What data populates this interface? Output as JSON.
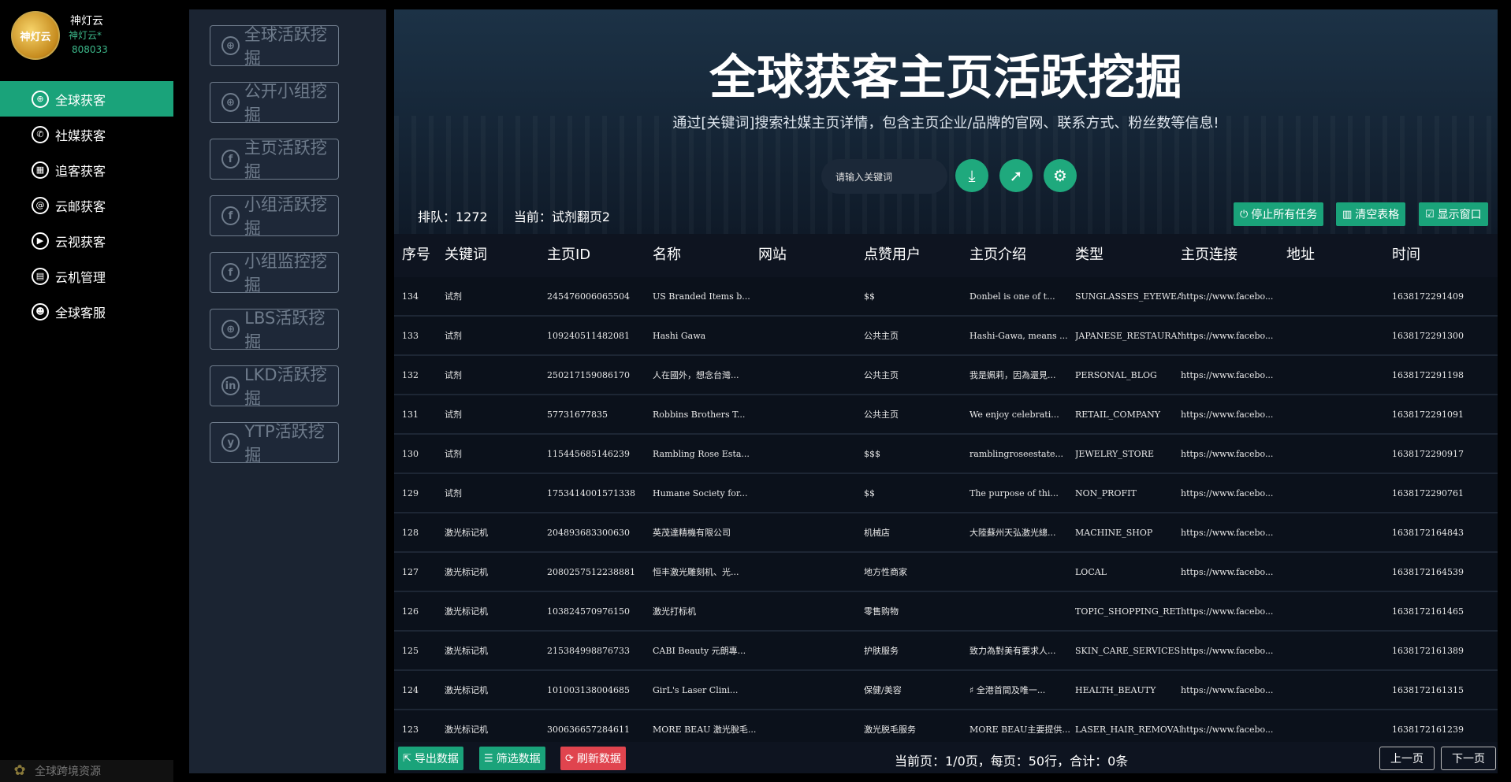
{
  "brand": {
    "name": "神灯云",
    "sub": "神灯云*",
    "id": "808033",
    "logo_text": "神灯云"
  },
  "nav": [
    {
      "label": "全球获客",
      "icon": "globe-icon",
      "glyph": "⊕",
      "active": true
    },
    {
      "label": "社媒获客",
      "icon": "whatsapp-icon",
      "glyph": "✆",
      "active": false
    },
    {
      "label": "追客获客",
      "icon": "grid-icon",
      "glyph": "▦",
      "active": false
    },
    {
      "label": "云邮获客",
      "icon": "mail-icon",
      "glyph": "@",
      "active": false
    },
    {
      "label": "云视获客",
      "icon": "play-icon",
      "glyph": "▶",
      "active": false
    },
    {
      "label": "云机管理",
      "icon": "server-icon",
      "glyph": "▤",
      "active": false
    },
    {
      "label": "全球客服",
      "icon": "support-icon",
      "glyph": "☻",
      "active": false
    }
  ],
  "sidebar_footer": "全球跨境资源",
  "mining_buttons": [
    {
      "label": "全球活跃挖掘",
      "icon": "globe-icon",
      "glyph": "⊕"
    },
    {
      "label": "公开小组挖掘",
      "icon": "globe-icon",
      "glyph": "⊕"
    },
    {
      "label": "主页活跃挖掘",
      "icon": "facebook-icon",
      "glyph": "f"
    },
    {
      "label": "小组活跃挖掘",
      "icon": "facebook-icon",
      "glyph": "f"
    },
    {
      "label": "小组监控挖掘",
      "icon": "facebook-icon",
      "glyph": "f"
    },
    {
      "label": "LBS活跃挖掘",
      "icon": "globe-icon",
      "glyph": "⊕"
    },
    {
      "label": "LKD活跃挖掘",
      "icon": "linkedin-icon",
      "glyph": "in"
    },
    {
      "label": "YTP活跃挖掘",
      "icon": "yelp-icon",
      "glyph": "y"
    }
  ],
  "hero": {
    "title": "全球获客主页活跃挖掘",
    "subtitle": "通过[关键词]搜索社媒主页详情，包含主页企业/品牌的官网、联系方式、粉丝数等信息!",
    "search_placeholder": "请输入关键词"
  },
  "status": {
    "queue": "排队：1272",
    "current": "当前：试剂翻页2"
  },
  "actions": {
    "stop": "停止所有任务",
    "clear": "清空表格",
    "show": "显示窗口"
  },
  "table": {
    "headers": [
      "序号",
      "关键词",
      "主页ID",
      "名称",
      "网站",
      "点赞用户",
      "主页介绍",
      "类型",
      "主页连接",
      "地址",
      "时间"
    ],
    "rows": [
      [
        "134",
        "试剂",
        "245476006065504",
        "US Branded Items b...",
        "",
        "$$",
        "Donbel is one of t...",
        "SUNGLASSES_EYEWEAR...",
        "https://www.facebo...",
        "",
        "1638172291409"
      ],
      [
        "133",
        "试剂",
        "109240511482081",
        "Hashi Gawa",
        "",
        "公共主页",
        "Hashi-Gawa, means ...",
        "JAPANESE_RESTAURANT",
        "https://www.facebo...",
        "",
        "1638172291300"
      ],
      [
        "132",
        "试剂",
        "250217159086170",
        "人在國外，想念台灣...",
        "",
        "公共主页",
        "我是姵莉，因為還見...",
        "PERSONAL_BLOG",
        "https://www.facebo...",
        "",
        "1638172291198"
      ],
      [
        "131",
        "试剂",
        "57731677835",
        "Robbins Brothers T...",
        "",
        "公共主页",
        "We enjoy celebrati...",
        "RETAIL_COMPANY",
        "https://www.facebo...",
        "",
        "1638172291091"
      ],
      [
        "130",
        "试剂",
        "115445685146239",
        "Rambling Rose Esta...",
        "",
        "$$$",
        "ramblingroseestate...",
        "JEWELRY_STORE",
        "https://www.facebo...",
        "",
        "1638172290917"
      ],
      [
        "129",
        "试剂",
        "1753414001571338",
        "Humane Society for...",
        "",
        "$$",
        "The purpose of thi...",
        "NON_PROFIT",
        "https://www.facebo...",
        "",
        "1638172290761"
      ],
      [
        "128",
        "激光标记机",
        "204893683300630",
        "英茂達精機有限公司",
        "",
        "机械店",
        "大陸蘇州天弘激光總...",
        "MACHINE_SHOP",
        "https://www.facebo...",
        "",
        "1638172164843"
      ],
      [
        "127",
        "激光标记机",
        "2080257512238881",
        "恒丰激光雕刻机、光...",
        "",
        "地方性商家",
        "",
        "LOCAL",
        "https://www.facebo...",
        "",
        "1638172164539"
      ],
      [
        "126",
        "激光标记机",
        "103824570976150",
        "激光打标机",
        "",
        "零售购物",
        "",
        "TOPIC_SHOPPING_RETAIL",
        "https://www.facebo...",
        "",
        "1638172161465"
      ],
      [
        "125",
        "激光标记机",
        "215384998876733",
        "CABI Beauty 元朗專...",
        "",
        "护肤服务",
        "致力為對美有要求人...",
        "SKIN_CARE_SERVICES",
        "https://www.facebo...",
        "",
        "1638172161389"
      ],
      [
        "124",
        "激光标记机",
        "101003138004685",
        "GirL's Laser Clini...",
        "",
        "保健/美容",
        "    ♯  全港首間及唯一...",
        "HEALTH_BEAUTY",
        "https://www.facebo...",
        "",
        "1638172161315"
      ],
      [
        "123",
        "激光标记机",
        "300636657284611",
        "MORE BEAU 激光脫毛...",
        "",
        "激光脱毛服务",
        "MORE BEAU主要提供...",
        "LASER_HAIR_REMOVAL",
        "https://www.facebo...",
        "",
        "1638172161239"
      ]
    ]
  },
  "footer": {
    "export": "导出数据",
    "filter": "筛选数据",
    "refresh": "刷新数据",
    "pager": "当前页：1/0页，每页：50行，合计：0条",
    "prev": "上一页",
    "next": "下一页"
  },
  "colors": {
    "accent": "#1aa37a",
    "refresh": "#e0444e",
    "panel": "#1b2432",
    "main_bg": "#0e1420"
  }
}
